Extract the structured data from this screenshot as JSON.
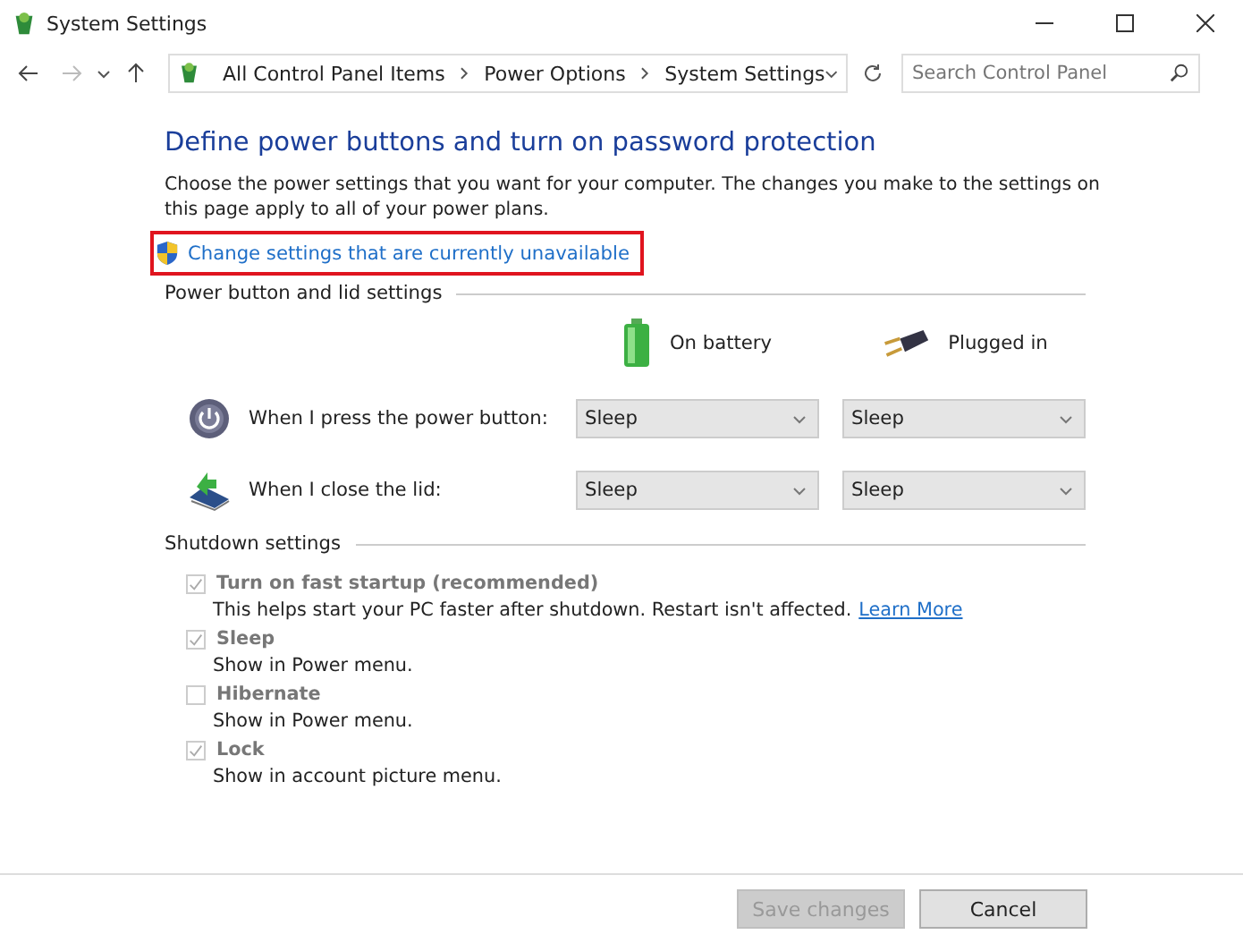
{
  "window": {
    "title": "System Settings"
  },
  "address_bar": {
    "crumbs": [
      "All Control Panel Items",
      "Power Options",
      "System Settings"
    ]
  },
  "search": {
    "placeholder": "Search Control Panel"
  },
  "heading": "Define power buttons and turn on password protection",
  "description": "Choose the power settings that you want for your computer. The changes you make to the settings on this page apply to all of your power plans.",
  "admin_link": {
    "label": "Change settings that are currently unavailable",
    "highlighted": true
  },
  "power_section": {
    "title": "Power button and lid settings",
    "columns": [
      {
        "kind": "battery",
        "label": "On battery"
      },
      {
        "kind": "plug",
        "label": "Plugged in"
      }
    ],
    "rows": [
      {
        "kind": "power",
        "label": "When I press the power button:",
        "values": [
          "Sleep",
          "Sleep"
        ]
      },
      {
        "kind": "lid",
        "label": "When I close the lid:",
        "values": [
          "Sleep",
          "Sleep"
        ]
      }
    ]
  },
  "shutdown_section": {
    "title": "Shutdown settings",
    "options": [
      {
        "label": "Turn on fast startup (recommended)",
        "checked": true,
        "disabled": true,
        "description": "This helps start your PC faster after shutdown. Restart isn't affected.",
        "link": "Learn More"
      },
      {
        "label": "Sleep",
        "checked": true,
        "disabled": true,
        "description": "Show in Power menu."
      },
      {
        "label": "Hibernate",
        "checked": false,
        "disabled": true,
        "description": "Show in Power menu."
      },
      {
        "label": "Lock",
        "checked": true,
        "disabled": true,
        "description": "Show in account picture menu."
      }
    ]
  },
  "buttons": [
    {
      "label": "Save changes",
      "disabled": true
    },
    {
      "label": "Cancel",
      "disabled": false
    }
  ]
}
